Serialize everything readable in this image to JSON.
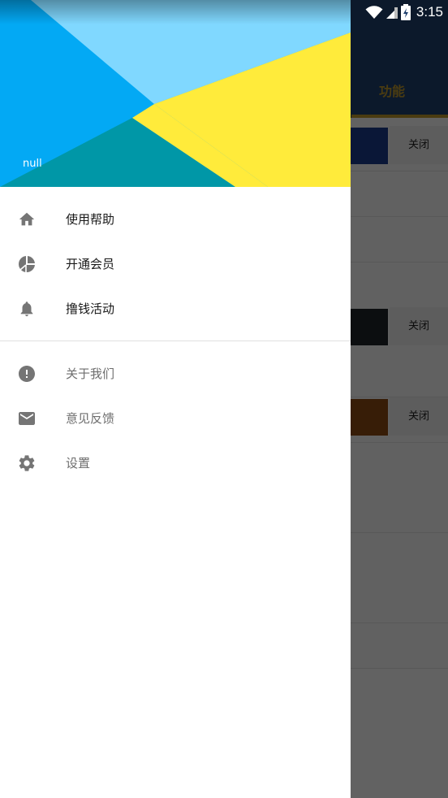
{
  "status_bar": {
    "time": "3:15"
  },
  "background": {
    "tab_label": "功能",
    "rows": [
      {
        "swatch": "#1b3a8a",
        "button": "关闭"
      },
      {
        "swatch": "#1e2528",
        "button": "关闭"
      },
      {
        "swatch": "#8a4a12",
        "button": "关闭"
      }
    ]
  },
  "drawer": {
    "header": {
      "user_name": "null"
    },
    "primary_menu": [
      {
        "label": "使用帮助",
        "icon": "home-icon"
      },
      {
        "label": "开通会员",
        "icon": "pie-chart-icon"
      },
      {
        "label": "撸钱活动",
        "icon": "bell-icon"
      }
    ],
    "secondary_menu": [
      {
        "label": "关于我们",
        "icon": "info-alert-icon"
      },
      {
        "label": "意见反馈",
        "icon": "mail-icon"
      },
      {
        "label": "设置",
        "icon": "gear-icon"
      }
    ]
  },
  "colors": {
    "header_blue": "#03a9f4",
    "header_light_blue": "#80d8ff",
    "header_teal": "#0097a7",
    "header_yellow": "#ffeb3b",
    "icon_gray": "#757575"
  }
}
